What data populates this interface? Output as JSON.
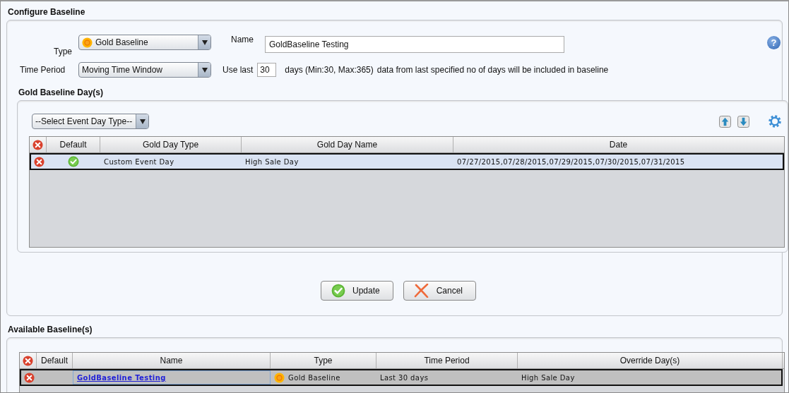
{
  "title": "Configure Baseline",
  "form": {
    "type_label": "Type",
    "type_value": "Gold Baseline",
    "name_label": "Name",
    "name_value": "GoldBaseline Testing",
    "help": "?",
    "period_label": "Time Period",
    "period_value": "Moving Time Window",
    "use_last_label": "Use last",
    "use_last_value": "30",
    "days_hint": "days (Min:30, Max:365)",
    "days_note": "data from last specified no of days will be included in baseline"
  },
  "days_section": {
    "title": "Gold Baseline Day(s)",
    "event_select": "--Select Event Day Type--",
    "columns": [
      "Default",
      "Gold Day Type",
      "Gold Day Name",
      "Date"
    ],
    "rows": [
      {
        "default": true,
        "selected": true,
        "type": "Custom Event Day",
        "name": "High Sale Day",
        "date": "07/27/2015,07/28/2015,07/29/2015,07/30/2015,07/31/2015"
      }
    ]
  },
  "buttons": [
    {
      "kind": "update",
      "label": "Update"
    },
    {
      "kind": "cancel",
      "label": "Cancel"
    }
  ],
  "available": {
    "title": "Available Baseline(s)",
    "columns": [
      "Default",
      "Name",
      "Type",
      "Time Period",
      "Override Day(s)"
    ],
    "rows": [
      {
        "default": false,
        "selected": true,
        "name": "GoldBaseline Testing",
        "type": "Gold Baseline",
        "period": "Last 30 days",
        "override": "High Sale Day"
      }
    ]
  }
}
